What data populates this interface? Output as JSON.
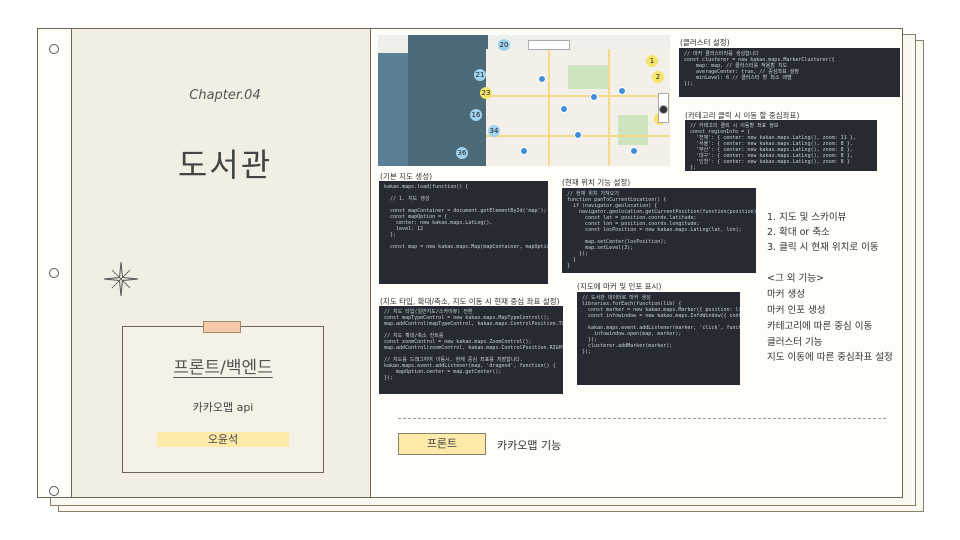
{
  "chapter": "Chapter.04",
  "title": "도서관",
  "card": {
    "title": "프론트/백엔드",
    "subtitle": "카카오맵 api",
    "name": "오윤석"
  },
  "captions": {
    "cluster": "(클러스터 설정)",
    "category": "(카테고리 클릭 시 이동 할 중심좌표)",
    "basic_map": "(기본 지도 생성)",
    "current_pos": "(현재 위치 기능 설정)",
    "map_type": "(지도 타입, 확대/축소, 지도 이동 시 현재 중심 좌표 설정)",
    "marker_info": "(지도에 마커 및 인포 표시)"
  },
  "code": {
    "cluster": "// 마커 클러스터러를 생성합니다\nconst clusterer = new kakao.maps.MarkerClusterer({\n    map: map, // 클러스터를 적용할 지도\n    averageCenter: true, // 중심좌표 설정\n    minLevel: 6 // 클러스터 할 최소 레벨\n});",
    "category": "// 카테고리 클릭 시 이동할 좌표 정보\nconst regionInfo = {\n  '전체': { center: new kakao.maps.LatLng(), zoom: 11 },\n  '서울': { center: new kakao.maps.LatLng(), zoom: 8 },\n  '부산': { center: new kakao.maps.LatLng(), zoom: 8 },\n  '대구': { center: new kakao.maps.LatLng(), zoom: 8 },\n  '인천': { center: new kakao.maps.LatLng(), zoom: 8 }\n};",
    "basic_map": "kakao.maps.load(function() {\n\n  // 1. 지도 생성\n\n  const mapContainer = document.getElementById('map');\n  const mapOption = {\n    center: new kakao.maps.LatLng(),\n    level: 12\n  };\n\n  const map = new kakao.maps.Map(mapContainer, mapOption);",
    "current_pos": "// 현재 위치 가져오기\nfunction panToCurrentLocation() {\n  if (navigator.geolocation) {\n    navigator.geolocation.getCurrentPosition(function(position) {\n      const lat = position.coords.latitude;\n      const lon = position.coords.longitude;\n      const locPosition = new kakao.maps.LatLng(lat, lon);\n\n      map.setCenter(locPosition);\n      map.setLevel(3);\n    });\n  }\n}",
    "map_type": "// 지도 타입(일반지도/스카이뷰) 전환\nconst mapTypeControl = new kakao.maps.MapTypeControl();\nmap.addControl(mapTypeControl, kakao.maps.ControlPosition.TOPRIGHT);\n\n// 지도 확대/축소 컨트롤\nconst zoomControl = new kakao.maps.ZoomControl();\nmap.addControl(zoomControl, kakao.maps.ControlPosition.RIGHT);\n\n// 지도를 드래그하여 이동시, 현재 중심 좌표를 저장합니다.\nkakao.maps.event.addListener(map, 'dragend', function() {\n    mapOption.center = map.getCenter();\n});",
    "marker_info": "// 도서관 데이터로 마커 생성\nlibraries.forEach(function(lib) {\n  const marker = new kakao.maps.Marker({ position: lib.latlng });\n  const infowindow = new kakao.maps.InfoWindow({ content: lib.name });\n\n  kakao.maps.event.addListener(marker, 'click', function() {\n    infowindow.open(map, marker);\n  });\n  clusterer.addMarker(marker);\n});"
  },
  "map_clusters": [
    "21",
    "23",
    "16",
    "34",
    "1",
    "2",
    "3",
    "36",
    "20"
  ],
  "features_main": [
    "1. 지도 및 스카이뷰",
    "2. 확대 or 축소",
    "3. 클릭 시 현재 위치로 이동"
  ],
  "features_other_title": "<그 외 기능>",
  "features_other": [
    "마커 생성",
    "마커 인포 생성",
    "카테고리에 따른 중심 이동",
    "클러스터 기능",
    "지도 이동에 따른 중심좌표 설정"
  ],
  "badge": "프론트",
  "badge_desc": "카카오맵 기능",
  "colors": {
    "accent_yellow": "#fde9a8",
    "tab_peach": "#f7c9a8",
    "paper": "#fffdf8",
    "panel": "#f3eee4",
    "code_bg": "#262a33"
  }
}
